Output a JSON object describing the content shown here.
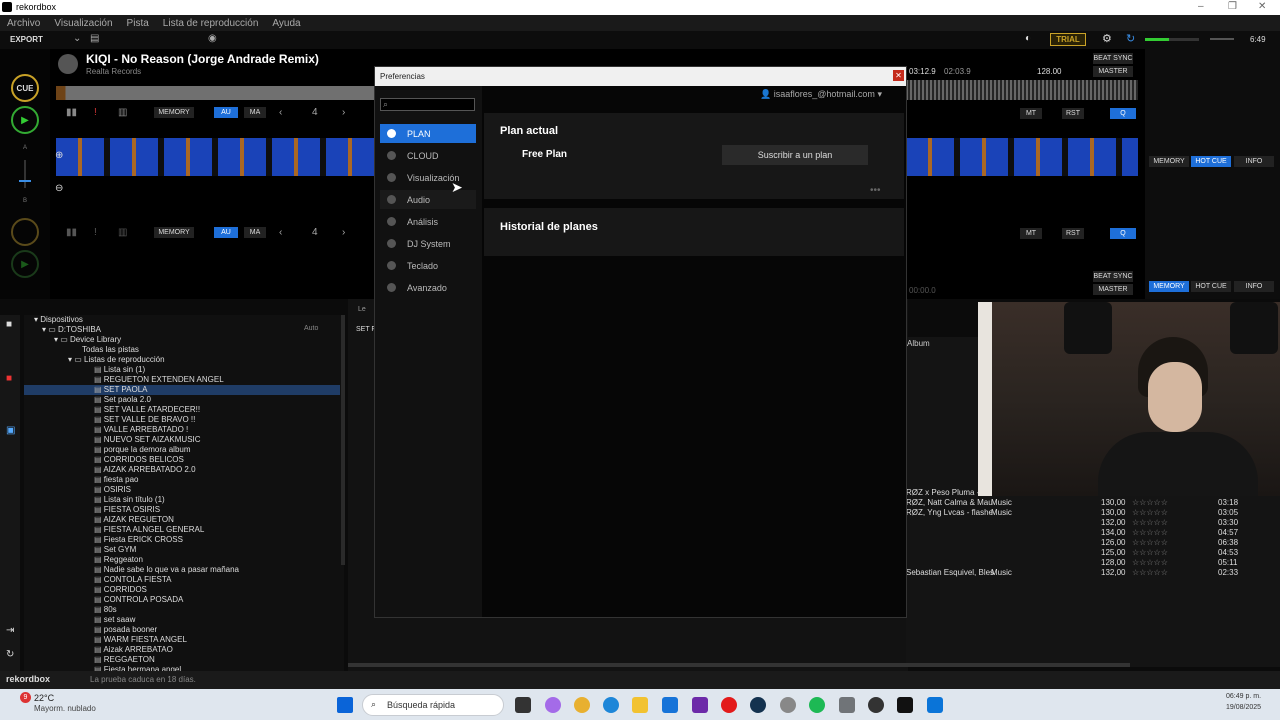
{
  "app": {
    "title": "rekordbox"
  },
  "menu": [
    "Archivo",
    "Visualización",
    "Pista",
    "Lista de reproducción",
    "Ayuda"
  ],
  "toolbar": {
    "export": "EXPORT",
    "trial": "TRIAL",
    "time": "6:49"
  },
  "deck1": {
    "cue": "CUE",
    "title": "KIQI - No Reason (Jorge Andrade Remix)",
    "label": "Realta Records",
    "memory": "MEMORY",
    "au": "AU",
    "ma": "MA",
    "beat": "4",
    "mt": "MT",
    "rst": "RST",
    "q": "Q",
    "time_elapsed": "03:12.9",
    "time_remain": "02:03.9",
    "bpm": "128.00",
    "beat_sync": "BEAT SYNC",
    "master": "MASTER",
    "a": "A",
    "b": "B"
  },
  "deck2": {
    "memory": "MEMORY",
    "au": "AU",
    "ma": "MA",
    "beat": "4",
    "mt": "MT",
    "rst": "RST",
    "q": "Q",
    "beat_sync": "BEAT SYNC",
    "master": "MASTER",
    "time": "00:00.0"
  },
  "rightpanel": {
    "memory": "MEMORY",
    "hotcue": "HOT CUE",
    "info": "INFO"
  },
  "tree": {
    "dispositivos": "Dispositivos",
    "drive": "D:TOSHIBA",
    "auto": "Auto",
    "device_library": "Device Library",
    "todas": "Todas las pistas",
    "listas": "Listas de reproducción",
    "playlists": [
      "Lista sin (1)",
      "REGUETON EXTENDEN ANGEL",
      "SET PAOLA",
      "Set paola 2.0",
      "SET VALLE ATARDECER!!",
      "SET VALLE DE BRAVO !!",
      "VALLE ARREBATADO !",
      "NUEVO SET AIZAKMUSIC",
      "porque la demora album",
      "CORRIDOS BELICOS",
      "AIZAK ARREBATADO 2.0",
      "fiesta pao",
      "OSIRIS",
      "Lista sin título (1)",
      "FIESTA OSIRIS",
      "AIZAK REGUETON",
      "FIESTA ALNGEL GENERAL",
      "Fiesta ERICK CROSS",
      "Set GYM",
      "Reggeaton",
      "Nadie sabe lo que va a pasar mañana",
      "CONTOLA FIESTA",
      "CORRIDOS",
      "CONTROLA POSADA",
      "80s",
      "set saaw",
      "posada booner",
      "WARM FIESTA ANGEL",
      "Aizak ARREBATAO",
      "REGGAETON",
      "Fiesta hermana angel"
    ]
  },
  "list": {
    "header": "SET F",
    "tab": "Le",
    "album_col": "Album"
  },
  "tracks": [
    {
      "artist": "RØZ x Peso Pluma - I",
      "genre": "",
      "bpm": "",
      "time": ""
    },
    {
      "artist": "RØZ, Natt Calma & Mau",
      "genre": "Music",
      "bpm": "130,00",
      "time": "03:18"
    },
    {
      "artist": "RØZ, Yng Lvcas - flashe",
      "genre": "Music",
      "bpm": "130,00",
      "time": "03:05"
    },
    {
      "artist": "",
      "genre": "",
      "bpm": "132,00",
      "time": "03:30"
    },
    {
      "artist": "",
      "genre": "",
      "bpm": "134,00",
      "time": "04:57"
    },
    {
      "artist": "",
      "genre": "",
      "bpm": "126,00",
      "time": "06:38"
    },
    {
      "artist": "",
      "genre": "",
      "bpm": "125,00",
      "time": "04:53"
    },
    {
      "artist": "",
      "genre": "",
      "bpm": "128,00",
      "time": "05:11"
    },
    {
      "artist": "Sebastian Esquivel, Bles",
      "genre": "Music",
      "bpm": "132,00",
      "time": "02:33"
    }
  ],
  "status": {
    "brand": "rekordbox",
    "trial_msg": "La prueba caduca en 18 días."
  },
  "taskbar": {
    "temp": "22°C",
    "weather": "Mayorm. nublado",
    "search": "Búsqueda rápida",
    "clock_time": "06:49 p. m.",
    "clock_date": "19/08/2025",
    "badge": "9"
  },
  "dialog": {
    "title": "Preferencias",
    "user": "isaaflores_@hotmail.com",
    "nav": [
      "PLAN",
      "CLOUD",
      "Visualización",
      "Audio",
      "Análisis",
      "DJ System",
      "Teclado",
      "Avanzado"
    ],
    "plan_actual": "Plan actual",
    "free_plan": "Free Plan",
    "subscribe": "Suscribir a un plan",
    "historial": "Historial de planes"
  },
  "colors": {
    "accent": "#1e6fd9",
    "cue_ring": "#c9a227",
    "play_ring": "#33aa33",
    "trial": "#c9a227"
  }
}
